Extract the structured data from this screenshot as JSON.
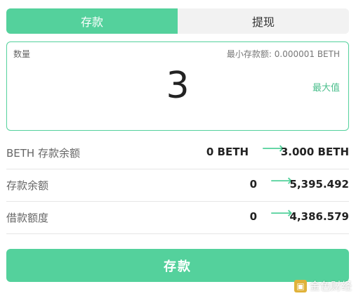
{
  "tabs": {
    "deposit": "存款",
    "withdraw": "提现"
  },
  "amount_box": {
    "quantity_label": "数量",
    "min_deposit_label": "最小存款额: 0.000001 BETH",
    "value": "3",
    "max_label": "最大值"
  },
  "rows": [
    {
      "label": "BETH 存款余额",
      "from": "0 BETH",
      "to": "3.000 BETH"
    },
    {
      "label": "存款余额",
      "from": "0",
      "to": "5,395.492"
    },
    {
      "label": "借款额度",
      "from": "0",
      "to": "4,386.579"
    }
  ],
  "arrow_symbol": "⟶",
  "submit_label": "存款",
  "watermark": {
    "logo_char": "▣",
    "text": "金色财经"
  },
  "colors": {
    "accent": "#54d19c",
    "tab_inactive_bg": "#f2f2f2"
  }
}
